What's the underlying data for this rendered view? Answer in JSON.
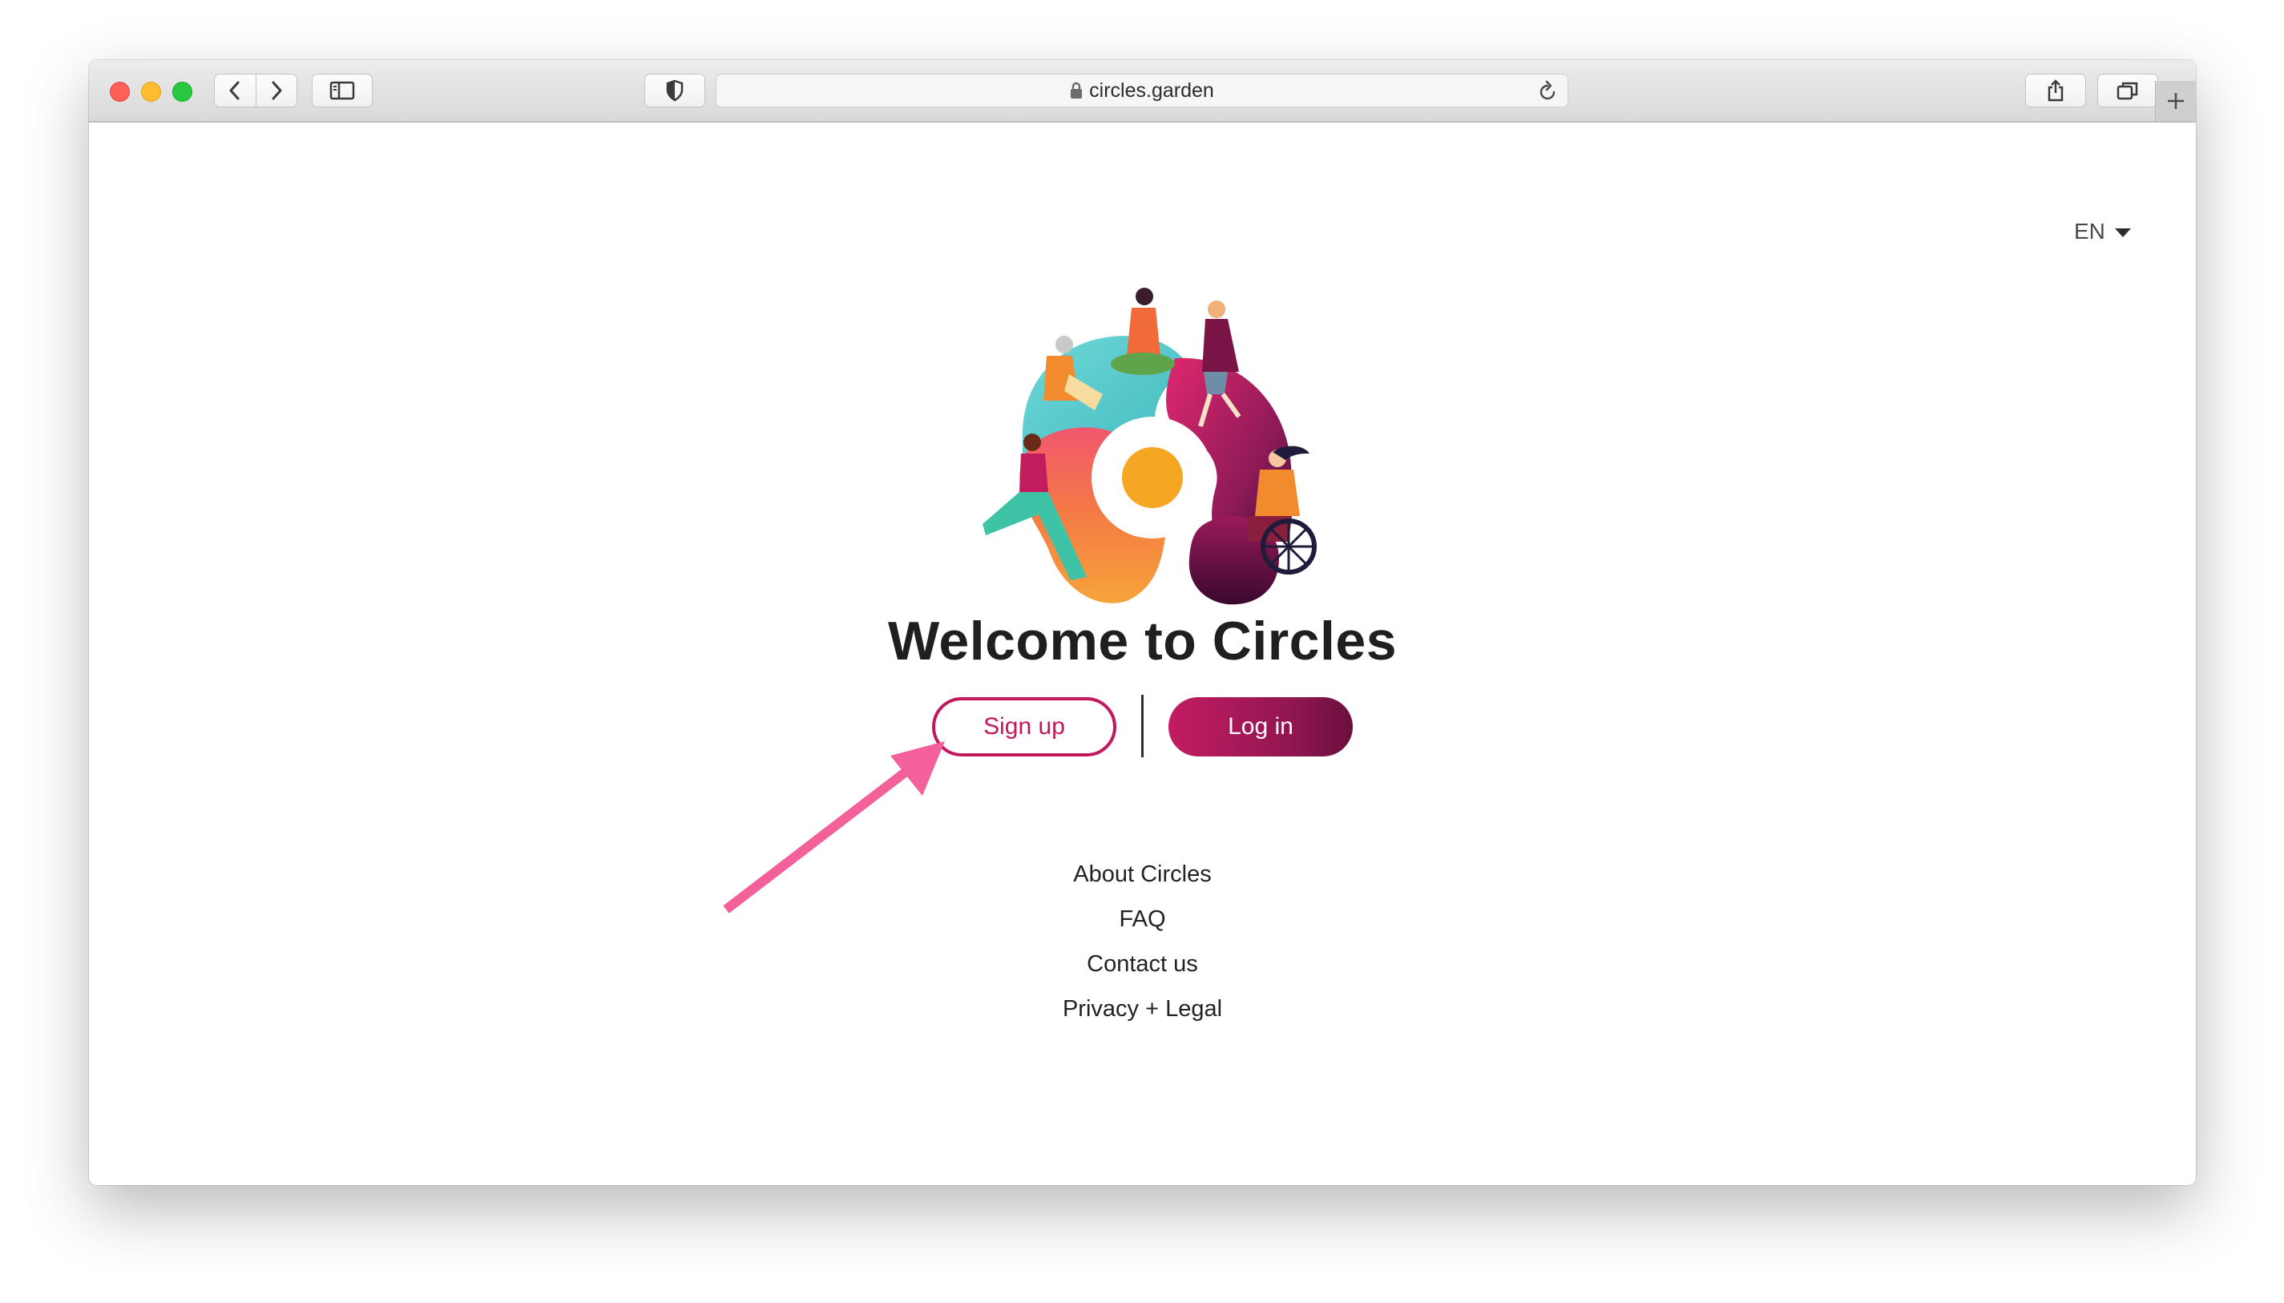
{
  "browser": {
    "url": "circles.garden",
    "icons": {
      "back": "chevron-left-icon",
      "forward": "chevron-right-icon",
      "sidebar": "sidebar-icon",
      "privacy": "shield-icon",
      "lock": "lock-icon",
      "reload": "reload-icon",
      "share": "share-icon",
      "tabs": "tab-overview-icon",
      "new_tab": "plus-icon"
    }
  },
  "header": {
    "language": "EN"
  },
  "main": {
    "title": "Welcome to Circles",
    "signup_label": "Sign up",
    "login_label": "Log in"
  },
  "footer_links": [
    "About Circles",
    "FAQ",
    "Contact us",
    "Privacy + Legal"
  ],
  "colors": {
    "brand": "#c3185d",
    "brand_dark": "#6a0f3c",
    "annotation_arrow": "#f4609a"
  }
}
